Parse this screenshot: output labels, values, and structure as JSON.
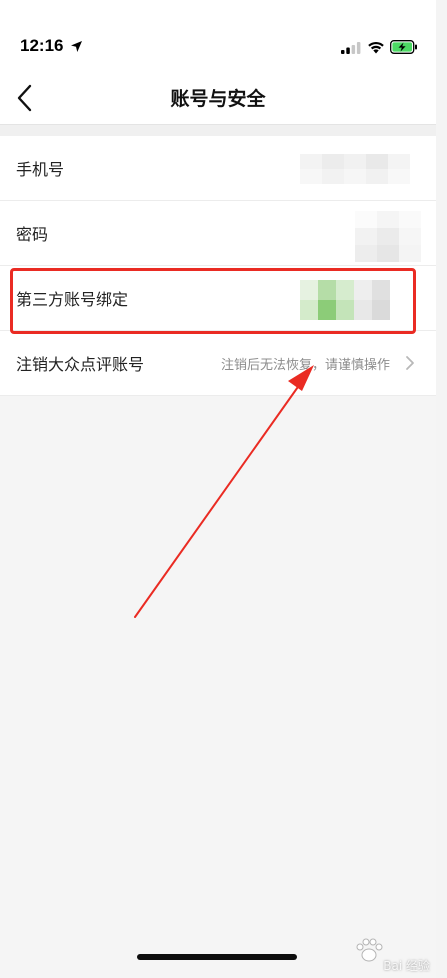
{
  "status_bar": {
    "time": "12:16",
    "location_icon": "location-arrow-icon",
    "signal_icon": "cellular-signal-icon",
    "wifi_icon": "wifi-icon",
    "battery_icon": "battery-charging-icon",
    "battery_color": "#4cd964"
  },
  "nav": {
    "title": "账号与安全",
    "back_icon": "chevron-left-icon"
  },
  "rows": [
    {
      "label": "手机号",
      "value": ""
    },
    {
      "label": "密码",
      "value": ""
    },
    {
      "label": "第三方账号绑定",
      "value": ""
    },
    {
      "label": "注销大众点评账号",
      "value": "注销后无法恢复，请谨慎操作"
    }
  ],
  "annotation": {
    "highlight_color": "#ea2b23",
    "arrow_color": "#ea2b23"
  },
  "watermark": {
    "text": "Bai 经验",
    "logo": "paw-icon"
  }
}
